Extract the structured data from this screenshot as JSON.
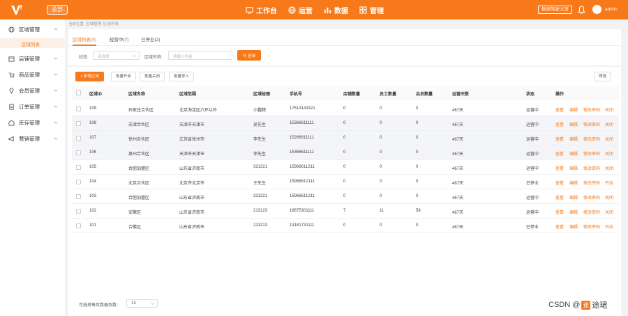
{
  "header": {
    "brand": "总部",
    "nav": [
      {
        "label": "工作台",
        "icon": "monitor-icon"
      },
      {
        "label": "运营",
        "icon": "globe-icon"
      },
      {
        "label": "数据",
        "icon": "bar-chart-icon"
      },
      {
        "label": "管理",
        "icon": "grid-icon"
      }
    ],
    "bigscreen": "数据驾驶大屏",
    "username": "admin",
    "accent": "#f7791a"
  },
  "sidebar": {
    "items": [
      {
        "label": "区域管理",
        "icon": "globe-icon"
      },
      {
        "label": "店铺管理",
        "icon": "store-icon"
      },
      {
        "label": "商品管理",
        "icon": "cart-icon"
      },
      {
        "label": "会员管理",
        "icon": "diamond-icon"
      },
      {
        "label": "订单管理",
        "icon": "order-icon"
      },
      {
        "label": "库存管理",
        "icon": "warehouse-icon"
      },
      {
        "label": "营销管理",
        "icon": "megaphone-icon"
      }
    ],
    "active_sub": "区域列表"
  },
  "breadcrumb": [
    "当前位置",
    "区域管理",
    "区域列表"
  ],
  "tabs": [
    "区域列表(9)",
    "经营中(7)",
    "已停业(2)"
  ],
  "filters": {
    "status_label": "状态:",
    "status_placeholder": "请选择",
    "name_label": "区域名称:",
    "name_placeholder": "请输入内容",
    "query": "查询"
  },
  "actions": {
    "add": "+ 新增区域",
    "batch_open": "批量开启",
    "batch_close": "批量关闭",
    "batch_import": "批量导入",
    "filter": "筛选"
  },
  "table": {
    "columns": [
      "区域ID",
      "区域名称",
      "区域范围",
      "区域经理",
      "手机号",
      "店铺数量",
      "员工数量",
      "会员数量",
      "运营天数",
      "状态",
      "操作"
    ],
    "rows": [
      {
        "id": "109",
        "name": "石家庄合伙区",
        "range": "北京海淀区六环以外",
        "manager": "小趣精",
        "phone": "17513143321",
        "stores": "0",
        "staff": "0",
        "members": "0",
        "days": "467天",
        "status": "运营中",
        "ops": [
          "查看",
          "编辑",
          "修改密码",
          "关闭"
        ]
      },
      {
        "id": "108",
        "name": "天津合伙区",
        "range": "天津市天津市",
        "manager": "吴先生",
        "phone": "15366611111",
        "stores": "0",
        "staff": "0",
        "members": "0",
        "days": "467天",
        "status": "运营中",
        "ops": [
          "查看",
          "编辑",
          "修改密码",
          "关闭"
        ]
      },
      {
        "id": "107",
        "name": "徐州合伙区",
        "range": "江苏省徐州市",
        "manager": "李先生",
        "phone": "15266611111",
        "stores": "0",
        "staff": "0",
        "members": "0",
        "days": "467天",
        "status": "运营中",
        "ops": [
          "查看",
          "编辑",
          "修改密码",
          "关闭"
        ]
      },
      {
        "id": "106",
        "name": "泉州合伙区",
        "range": "天津市天津市",
        "manager": "李先生",
        "phone": "15366611111",
        "stores": "0",
        "staff": "0",
        "members": "0",
        "days": "467天",
        "status": "运营中",
        "ops": [
          "查看",
          "编辑",
          "修改密码",
          "关闭"
        ]
      },
      {
        "id": "105",
        "name": "合肥加盟区",
        "range": "山东省济南市",
        "manager": "321321",
        "phone": "15966611211",
        "stores": "0",
        "staff": "0",
        "members": "0",
        "days": "467天",
        "status": "运营中",
        "ops": [
          "查看",
          "编辑",
          "修改密码",
          "关闭"
        ]
      },
      {
        "id": "104",
        "name": "北京合伙区",
        "range": "北京市北京市",
        "manager": "王先生",
        "phone": "15966612111",
        "stores": "0",
        "staff": "0",
        "members": "0",
        "days": "467天",
        "status": "已停业",
        "ops": [
          "查看",
          "编辑",
          "修改密码",
          "开启"
        ]
      },
      {
        "id": "103",
        "name": "合肥加盟区",
        "range": "山东省济南市",
        "manager": "321321",
        "phone": "15966611211",
        "stores": "0",
        "staff": "0",
        "members": "0",
        "days": "467天",
        "status": "运营中",
        "ops": [
          "查看",
          "编辑",
          "修改密码",
          "关闭"
        ]
      },
      {
        "id": "102",
        "name": "安徽区",
        "range": "山东省济南市",
        "manager": "213123",
        "phone": "18675301111",
        "stores": "7",
        "staff": "11",
        "members": "58",
        "days": "467天",
        "status": "运营中",
        "ops": [
          "查看",
          "编辑",
          "修改密码",
          "关闭"
        ]
      },
      {
        "id": "101",
        "name": "合徽区",
        "range": "山东省济南市",
        "manager": "213213",
        "phone": "13181731111",
        "stores": "0",
        "staff": "0",
        "members": "0",
        "days": "467天",
        "status": "已停业",
        "ops": [
          "查看",
          "编辑",
          "修改密码",
          "开启"
        ]
      }
    ]
  },
  "pager": {
    "label": "可选择每页数据条数:",
    "value": "13"
  },
  "watermark": {
    "text": "CSDN @",
    "mark": "途",
    "name": "途珺"
  }
}
